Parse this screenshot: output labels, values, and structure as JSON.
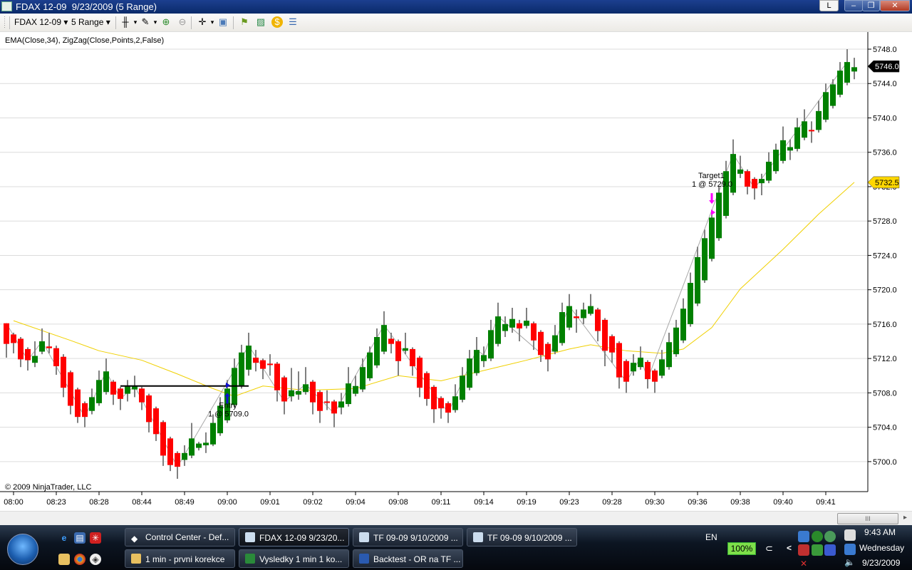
{
  "window": {
    "title": "FDAX 12-09  9/23/2009 (5 Range)",
    "link_button": "L",
    "minimize": "–",
    "maximize": "❐",
    "close": "✕"
  },
  "toolbar": {
    "instrument": "FDAX 12-09",
    "period": "5 Range",
    "dropdown_glyph": "▾",
    "icons": [
      "bar-type-icon",
      "drawing-pencil-icon",
      "zoom-in-icon",
      "zoom-out-icon",
      "crosshair-icon",
      "properties-icon",
      "strategies-icon",
      "indicators-icon",
      "chart-trader-icon",
      "data-box-icon"
    ]
  },
  "chart": {
    "indicator_label": "EMA(Close,34), ZigZag(Close,Points,2,False)",
    "copyright": "© 2009 NinjaTrader, LLC",
    "last_price_label": "5746.0",
    "ema_price_label": "5732.5",
    "entry": {
      "title": "Entry",
      "detail": "1 @ 5709.0",
      "bar": 31,
      "price": 5709.0,
      "line_price": 5708.8,
      "line_from_bar": 16,
      "line_to_bar": 34
    },
    "target": {
      "title": "Target1",
      "detail": "1 @ 5729.0",
      "bar": 99,
      "price": 5729.0
    },
    "colors": {
      "up": "#008000",
      "down": "#ff0000",
      "wick": "#808080",
      "ema": "#f0d000",
      "zigzag": "#a8a8a8",
      "entry": "#1010d0",
      "target": "#ff00ff",
      "last": "#000000",
      "ema_label": "#ffd700"
    }
  },
  "chart_data": {
    "type": "candlestick",
    "title": "FDAX 12-09 9/23/2009 (5 Range)",
    "ylim": [
      5697,
      5750
    ],
    "yticks": [
      5748,
      5744,
      5740,
      5736,
      5732,
      5728,
      5724,
      5720,
      5716,
      5712,
      5708,
      5704,
      5700
    ],
    "ytick_labels": [
      "5748.0",
      "5744.0",
      "5740.0",
      "5736.0",
      "5732.0",
      "5728.0",
      "5724.0",
      "5720.0",
      "5716.0",
      "5712.0",
      "5708.0",
      "5704.0",
      "5700.0"
    ],
    "xtick_bars": [
      1,
      7,
      13,
      19,
      25,
      31,
      37,
      43,
      49,
      55,
      61,
      67,
      73,
      79,
      85,
      91,
      97,
      103,
      109,
      115
    ],
    "xtick_labels": [
      "08:00",
      "08:23",
      "08:28",
      "08:44",
      "08:49",
      "09:00",
      "09:01",
      "09:02",
      "09:04",
      "09:08",
      "09:11",
      "09:14",
      "09:19",
      "09:23",
      "09:28",
      "09:30",
      "09:36",
      "09:38",
      "09:40",
      "09:41"
    ],
    "ohlc": [
      [
        5716.1,
        5716.1,
        5712.1,
        5713.7
      ],
      [
        5714.8,
        5715,
        5712.6,
        5713.8
      ],
      [
        5714.3,
        5714.5,
        5711,
        5711.9
      ],
      [
        5713.1,
        5713.3,
        5710.6,
        5711.8
      ],
      [
        5711.5,
        5714,
        5711,
        5712.3
      ],
      [
        5712.8,
        5715.5,
        5712.5,
        5714
      ],
      [
        5713.4,
        5715,
        5712.6,
        5713.2
      ],
      [
        5713.2,
        5713.5,
        5710.1,
        5711.1
      ],
      [
        5712.2,
        5712.5,
        5707.5,
        5708.6
      ],
      [
        5710.4,
        5710.6,
        5705.5,
        5706.5
      ],
      [
        5708.4,
        5708.6,
        5704.5,
        5705.2
      ],
      [
        5706.8,
        5707,
        5704,
        5705.2
      ],
      [
        5705.9,
        5708.5,
        5705.5,
        5707.5
      ],
      [
        5706.8,
        5710.6,
        5706.5,
        5709.5
      ],
      [
        5708.1,
        5712,
        5707.8,
        5710.5
      ],
      [
        5709.3,
        5709.5,
        5706.6,
        5707.8
      ],
      [
        5708.5,
        5708.7,
        5706,
        5707.3
      ],
      [
        5707.9,
        5709.5,
        5707,
        5708.8
      ],
      [
        5708.4,
        5710,
        5707.5,
        5708.8
      ],
      [
        5708.5,
        5708.7,
        5706,
        5706.9
      ],
      [
        5707.7,
        5707.9,
        5703.4,
        5704.6
      ],
      [
        5706.2,
        5706.4,
        5702.4,
        5703.2
      ],
      [
        5704.6,
        5704.8,
        5699.5,
        5700.7
      ],
      [
        5702.7,
        5702.9,
        5698.9,
        5699.6
      ],
      [
        5701,
        5701.2,
        5698,
        5699.4
      ],
      [
        5700.2,
        5701.9,
        5699.5,
        5701
      ],
      [
        5700.7,
        5704.5,
        5700.4,
        5702.7
      ],
      [
        5701.6,
        5702.3,
        5701.3,
        5702.1
      ],
      [
        5701.9,
        5703.4,
        5701,
        5702.2
      ],
      [
        5702,
        5705.5,
        5701.8,
        5704.5
      ],
      [
        5703.3,
        5707.5,
        5703,
        5706.5
      ],
      [
        5704.8,
        5709.5,
        5704.5,
        5708.5
      ],
      [
        5706.6,
        5712,
        5706.3,
        5710.9
      ],
      [
        5708.8,
        5713.6,
        5708.5,
        5712.7
      ],
      [
        5710.7,
        5715,
        5710,
        5713.5
      ],
      [
        5712.1,
        5713,
        5710.5,
        5711.5
      ],
      [
        5711.8,
        5712,
        5709.6,
        5710.8
      ],
      [
        5711.4,
        5712.5,
        5710,
        5711.3
      ],
      [
        5711.4,
        5711.6,
        5707,
        5708.3
      ],
      [
        5709.8,
        5710,
        5705.5,
        5707
      ],
      [
        5707.6,
        5710.9,
        5707,
        5708.3
      ],
      [
        5707.8,
        5710.5,
        5707.2,
        5708.2
      ],
      [
        5708.1,
        5711,
        5707.8,
        5709
      ],
      [
        5709.3,
        5709.5,
        5705.5,
        5706.9
      ],
      [
        5708.1,
        5708.3,
        5704.5,
        5705.9
      ],
      [
        5707,
        5708.3,
        5706,
        5706.9
      ],
      [
        5707,
        5707.2,
        5704,
        5705.6
      ],
      [
        5706.3,
        5708,
        5705.5,
        5707
      ],
      [
        5706.7,
        5711,
        5706.4,
        5709.1
      ],
      [
        5707.9,
        5710,
        5707.6,
        5708.8
      ],
      [
        5708.4,
        5712,
        5708.1,
        5711
      ],
      [
        5709.7,
        5713.4,
        5709.4,
        5712.7
      ],
      [
        5711.2,
        5715.5,
        5710.9,
        5714.5
      ],
      [
        5712.8,
        5717.5,
        5712.5,
        5715.9
      ],
      [
        5714.3,
        5715,
        5712.6,
        5713.7
      ],
      [
        5714,
        5714.2,
        5710,
        5711.7
      ],
      [
        5712.9,
        5715,
        5712.5,
        5713.2
      ],
      [
        5713.1,
        5713.3,
        5710,
        5711.1
      ],
      [
        5712.1,
        5712.3,
        5707.5,
        5708.6
      ],
      [
        5710.3,
        5710.5,
        5706.5,
        5707.3
      ],
      [
        5708.7,
        5708.9,
        5704.5,
        5706.1
      ],
      [
        5707.4,
        5707.6,
        5705,
        5706.2
      ],
      [
        5706.8,
        5707,
        5704.5,
        5705.7
      ],
      [
        5706,
        5709,
        5705.7,
        5707.6
      ],
      [
        5707.2,
        5711,
        5706.9,
        5710
      ],
      [
        5708.6,
        5713,
        5708.3,
        5712
      ],
      [
        5710.3,
        5714.5,
        5710,
        5713
      ],
      [
        5711.7,
        5713.4,
        5711,
        5712.4
      ],
      [
        5712,
        5716.5,
        5711.7,
        5715.3
      ],
      [
        5713.7,
        5718.5,
        5713.4,
        5716.9
      ],
      [
        5715.2,
        5716.9,
        5714.5,
        5716
      ],
      [
        5715.6,
        5717.9,
        5715,
        5716.6
      ],
      [
        5716.1,
        5716.5,
        5714,
        5715.5
      ],
      [
        5715.8,
        5717.9,
        5715.5,
        5716.4
      ],
      [
        5716.1,
        5716.3,
        5713,
        5714.1
      ],
      [
        5715.1,
        5715.3,
        5711.6,
        5712.4
      ],
      [
        5713.7,
        5713.9,
        5710.5,
        5711.9
      ],
      [
        5712.8,
        5715.9,
        5712.5,
        5714.7
      ],
      [
        5713.8,
        5718.5,
        5713.5,
        5717.4
      ],
      [
        5715.6,
        5719.5,
        5715.3,
        5718.1
      ],
      [
        5716.9,
        5717.7,
        5715,
        5716.7
      ],
      [
        5716.7,
        5718.5,
        5716,
        5717.7
      ],
      [
        5717.2,
        5719.5,
        5717,
        5718.1
      ],
      [
        5717.7,
        5717.9,
        5714,
        5715.2
      ],
      [
        5716.5,
        5716.7,
        5711.1,
        5712.9
      ],
      [
        5714.6,
        5714.8,
        5711.5,
        5712.7
      ],
      [
        5713.8,
        5714,
        5708.5,
        5709.8
      ],
      [
        5711.7,
        5711.9,
        5708,
        5709.3
      ],
      [
        5710.5,
        5712.5,
        5710,
        5711.5
      ],
      [
        5711,
        5713.4,
        5710.7,
        5712.1
      ],
      [
        5711.6,
        5711.8,
        5708.5,
        5709.6
      ],
      [
        5710.6,
        5710.8,
        5708,
        5709.3
      ],
      [
        5710,
        5713,
        5709.7,
        5711.9
      ],
      [
        5711,
        5715,
        5710.7,
        5713.9
      ],
      [
        5712.5,
        5716.5,
        5712.2,
        5715.6
      ],
      [
        5714.1,
        5719,
        5713.8,
        5717.8
      ],
      [
        5716,
        5722,
        5715.7,
        5720.8
      ],
      [
        5718.4,
        5725,
        5718.1,
        5723.8
      ],
      [
        5721.1,
        5727,
        5720.8,
        5726
      ],
      [
        5723.6,
        5729.3,
        5723.3,
        5728.4
      ],
      [
        5726,
        5732,
        5725.7,
        5731.3
      ],
      [
        5728.6,
        5735,
        5728.3,
        5733.8
      ],
      [
        5731.3,
        5737.5,
        5731,
        5735.8
      ],
      [
        5733.5,
        5735.6,
        5733,
        5734
      ],
      [
        5733.8,
        5734,
        5731.1,
        5732
      ],
      [
        5732.9,
        5733.1,
        5730.5,
        5731.8
      ],
      [
        5732.4,
        5733.5,
        5731,
        5732.9
      ],
      [
        5732.7,
        5736,
        5732.4,
        5734.9
      ],
      [
        5733.8,
        5737,
        5733.5,
        5736.3
      ],
      [
        5735,
        5739,
        5734.7,
        5737.4
      ],
      [
        5736.2,
        5737.5,
        5735.1,
        5736.6
      ],
      [
        5736.4,
        5740,
        5736.1,
        5738.9
      ],
      [
        5737.7,
        5741,
        5737.4,
        5739.6
      ],
      [
        5738.6,
        5739.6,
        5737.1,
        5738.5
      ],
      [
        5738.6,
        5742,
        5738.3,
        5740.8
      ],
      [
        5739.8,
        5744,
        5739.5,
        5743
      ],
      [
        5741.4,
        5744.5,
        5741.1,
        5743.9
      ],
      [
        5742.7,
        5746.5,
        5742.4,
        5745.5
      ],
      [
        5744.1,
        5748,
        5743.8,
        5746.5
      ],
      [
        5745.4,
        5747,
        5744.5,
        5745.9
      ]
    ],
    "ema34": [
      [
        1,
        5716.4
      ],
      [
        9,
        5714.1
      ],
      [
        13,
        5712.9
      ],
      [
        19,
        5711.8
      ],
      [
        24,
        5710.2
      ],
      [
        29,
        5708.5
      ],
      [
        32,
        5707.6
      ],
      [
        36,
        5708.8
      ],
      [
        42,
        5708.3
      ],
      [
        49,
        5708.5
      ],
      [
        55,
        5710
      ],
      [
        61,
        5709.4
      ],
      [
        67,
        5710.6
      ],
      [
        73,
        5711.8
      ],
      [
        79,
        5713.1
      ],
      [
        82,
        5713.6
      ],
      [
        87,
        5712.9
      ],
      [
        92,
        5712.6
      ],
      [
        95,
        5713.1
      ],
      [
        99,
        5715.6
      ],
      [
        103,
        5720.1
      ],
      [
        109,
        5724.7
      ],
      [
        114,
        5728.8
      ],
      [
        119,
        5732.5
      ]
    ],
    "zigzag": [
      [
        0,
        5716.1
      ],
      [
        3,
        5711.8
      ],
      [
        5,
        5714
      ],
      [
        11,
        5705.2
      ],
      [
        14,
        5710.5
      ],
      [
        16,
        5707.3
      ],
      [
        18,
        5708.8
      ],
      [
        24,
        5699.4
      ],
      [
        34,
        5713.5
      ],
      [
        39,
        5707
      ],
      [
        42,
        5709
      ],
      [
        46,
        5705.6
      ],
      [
        53,
        5715.9
      ],
      [
        62,
        5705.7
      ],
      [
        66,
        5713
      ],
      [
        67,
        5712.4
      ],
      [
        69,
        5716.9
      ],
      [
        76,
        5711.9
      ],
      [
        79,
        5718.1
      ],
      [
        87,
        5709.3
      ],
      [
        89,
        5712.1
      ],
      [
        90,
        5709.6
      ],
      [
        102,
        5735.8
      ],
      [
        105,
        5731.8
      ],
      [
        118,
        5746.5
      ]
    ]
  },
  "scrollbar": {
    "thumb_glyph": "III",
    "right_arrow": "▸"
  },
  "taskbar": {
    "quick_launch": [
      "ie-icon",
      "show-desktop-icon",
      "app-icon",
      "folder-icon",
      "chrome-icon",
      "app2-icon"
    ],
    "tasks_row1": [
      "Control Center - Def...",
      "FDAX 12-09  9/23/20...",
      "TF 09-09  9/10/2009 ...",
      "TF 09-09  9/10/2009 ..."
    ],
    "tasks_row2": [
      "1 min - prvni korekce",
      "Vysledky 1 min 1 ko...",
      "Backtest - OR na TF ..."
    ],
    "language": "EN",
    "battery": "100%",
    "tray_expand": "<",
    "time": "9:43 AM",
    "day": "Wednesday",
    "date": "9/23/2009"
  }
}
